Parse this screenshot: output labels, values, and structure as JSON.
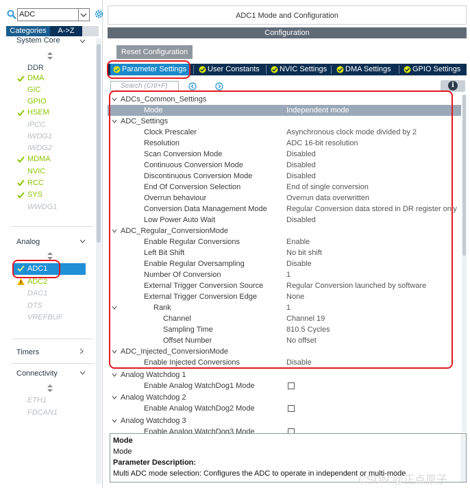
{
  "left": {
    "search_value": "ADC",
    "tabs": [
      "Categories",
      "A->Z"
    ],
    "system_core": {
      "label": "System Core",
      "items": [
        {
          "label": "DDR",
          "state": "normal"
        },
        {
          "label": "DMA",
          "state": "ok"
        },
        {
          "label": "GIC",
          "state": "normal-yellow"
        },
        {
          "label": "GPIO",
          "state": "normal-yellow"
        },
        {
          "label": "HSEM",
          "state": "ok"
        },
        {
          "label": "IPCC",
          "state": "disabled"
        },
        {
          "label": "IWDG1",
          "state": "disabled"
        },
        {
          "label": "IWDG2",
          "state": "disabled"
        },
        {
          "label": "MDMA",
          "state": "ok"
        },
        {
          "label": "NVIC",
          "state": "normal-yellow"
        },
        {
          "label": "RCC",
          "state": "ok"
        },
        {
          "label": "SYS",
          "state": "ok"
        },
        {
          "label": "WWDG1",
          "state": "disabled"
        }
      ]
    },
    "analog": {
      "label": "Analog",
      "items": [
        {
          "label": "ADC1",
          "state": "selected"
        },
        {
          "label": "ADC2",
          "state": "warning"
        },
        {
          "label": "DAC1",
          "state": "disabled"
        },
        {
          "label": "DTS",
          "state": "disabled"
        },
        {
          "label": "VREFBUF",
          "state": "disabled"
        }
      ]
    },
    "timers": {
      "label": "Timers"
    },
    "connectivity": {
      "label": "Connectivity",
      "items": [
        {
          "label": "ETH1",
          "state": "disabled"
        },
        {
          "label": "FDCAN1",
          "state": "disabled"
        }
      ]
    }
  },
  "right": {
    "title": "ADC1 Mode and Configuration",
    "config_label": "Configuration",
    "reset_label": "Reset Configuration",
    "tabs": [
      "Parameter Settings",
      "User Constants",
      "NVIC Settings",
      "DMA Settings",
      "GPIO Settings"
    ],
    "search_placeholder": "Search (Crtl+F)",
    "rows": [
      {
        "name": "ADCs_Common_Settings",
        "value": "",
        "kind": "group"
      },
      {
        "name": "Mode",
        "value": "Independent mode",
        "kind": "param",
        "selected": true
      },
      {
        "name": "ADC_Settings",
        "value": "",
        "kind": "group"
      },
      {
        "name": "Clock Prescaler",
        "value": "Asynchronous clock mode divided by 2",
        "kind": "param"
      },
      {
        "name": "Resolution",
        "value": "ADC 16-bit resolution",
        "kind": "param"
      },
      {
        "name": "Scan Conversion Mode",
        "value": "Disabled",
        "kind": "param"
      },
      {
        "name": "Continuous Conversion Mode",
        "value": "Disabled",
        "kind": "param"
      },
      {
        "name": "Discontinuous Conversion Mode",
        "value": "Disabled",
        "kind": "param"
      },
      {
        "name": "End Of Conversion Selection",
        "value": "End of single conversion",
        "kind": "param"
      },
      {
        "name": "Overrun behaviour",
        "value": " Overrun data overwritten",
        "kind": "param"
      },
      {
        "name": "Conversion Data Management Mode",
        "value": "Regular Conversion data stored in DR register only",
        "kind": "param"
      },
      {
        "name": "Low Power Auto Wait",
        "value": "Disabled",
        "kind": "param"
      },
      {
        "name": "ADC_Regular_ConversionMode",
        "value": "",
        "kind": "group"
      },
      {
        "name": "Enable Regular Conversions",
        "value": "Enable",
        "kind": "param"
      },
      {
        "name": "Left Bit Shift",
        "value": "No bit shift",
        "kind": "param"
      },
      {
        "name": "Enable Regular Oversampling",
        "value": "Disable",
        "kind": "param"
      },
      {
        "name": "Number Of Conversion",
        "value": "1",
        "kind": "param"
      },
      {
        "name": "External Trigger Conversion Source",
        "value": "Regular Conversion launched by software",
        "kind": "param"
      },
      {
        "name": "External Trigger Conversion Edge",
        "value": "None",
        "kind": "param"
      },
      {
        "name": "Rank",
        "value": "1",
        "kind": "rank"
      },
      {
        "name": "Channel",
        "value": "Channel 19",
        "kind": "sub"
      },
      {
        "name": "Sampling Time",
        "value": "810.5 Cycles",
        "kind": "sub"
      },
      {
        "name": "Offset Number",
        "value": "No offset",
        "kind": "sub"
      },
      {
        "name": "ADC_Injected_ConversionMode",
        "value": "",
        "kind": "group"
      },
      {
        "name": "Enable Injected Conversions",
        "value": "Disable",
        "kind": "param"
      },
      {
        "name": "Analog Watchdog 1",
        "value": "",
        "kind": "group"
      },
      {
        "name": "Enable Analog WatchDog1 Mode",
        "value": "",
        "kind": "checkbox"
      },
      {
        "name": "Analog Watchdog 2",
        "value": "",
        "kind": "group"
      },
      {
        "name": "Enable Analog WatchDog2 Mode",
        "value": "",
        "kind": "checkbox"
      },
      {
        "name": "Analog Watchdog 3",
        "value": "",
        "kind": "group"
      },
      {
        "name": "Enable Analog WatchDog3 Mode",
        "value": "",
        "kind": "checkbox"
      }
    ],
    "description": {
      "title": "Mode",
      "name": "Mode",
      "heading": "Parameter Description:",
      "text": "Multi ADC mode selection: Configures the ADC to operate in independent or multi-mode"
    },
    "watermark": "CSDN @正点原子"
  },
  "colors": {
    "accent_blue": "#1f8fd6",
    "tab_bar": "#0b2e52",
    "ok_green": "#8bc400",
    "highlight_red": "#e0181e"
  }
}
